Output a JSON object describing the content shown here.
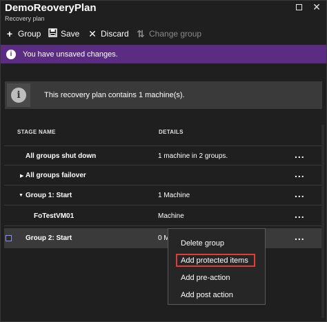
{
  "window": {
    "title": "DemoReoveryPlan",
    "subtitle": "Recovery plan",
    "maximize_icon": "square-icon",
    "close_icon": "close-icon"
  },
  "toolbar": {
    "group_label": "Group",
    "save_label": "Save",
    "discard_label": "Discard",
    "change_group_label": "Change group"
  },
  "banner": {
    "text": "You have unsaved changes.",
    "color": "#5a2d82"
  },
  "info": {
    "text": "This recovery plan contains 1 machine(s)."
  },
  "table": {
    "headers": {
      "stage": "STAGE NAME",
      "details": "DETAILS"
    },
    "rows": [
      {
        "stage": "All groups shut down",
        "details": "1 machine in 2 groups.",
        "more": "..."
      },
      {
        "stage": "All groups failover",
        "details": "",
        "more": "..."
      },
      {
        "stage": "Group 1: Start",
        "details": "1 Machine",
        "more": "..."
      },
      {
        "stage": "FoTestVM01",
        "details": "Machine",
        "more": "..."
      },
      {
        "stage": "Group 2: Start",
        "details": "0 M",
        "more": "..."
      }
    ]
  },
  "context_menu": {
    "items": [
      "Delete group",
      "Add protected items",
      "Add pre-action",
      "Add post action"
    ],
    "highlight_color": "#e03c3c"
  }
}
